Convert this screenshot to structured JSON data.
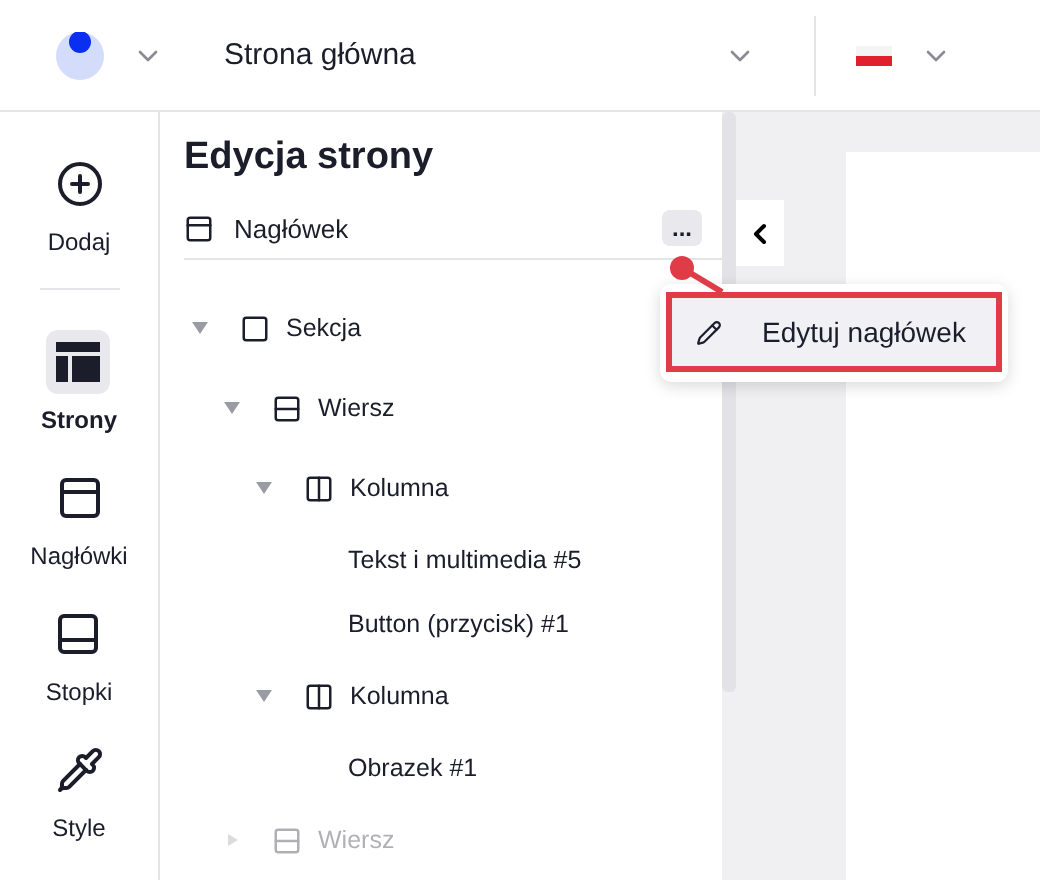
{
  "top_bar": {
    "page_select": {
      "value": "Strona główna"
    }
  },
  "rail": [
    {
      "label": "Dodaj",
      "kind": "add",
      "selected": false
    },
    {
      "label": "Strony",
      "kind": "pages",
      "selected": true
    },
    {
      "label": "Nagłówki",
      "kind": "headers",
      "selected": false
    },
    {
      "label": "Stopki",
      "kind": "footers",
      "selected": false
    },
    {
      "label": "Style",
      "kind": "style",
      "selected": false
    }
  ],
  "panel": {
    "title": "Edycja strony",
    "header_item": {
      "label": "Nagłówek",
      "more": "..."
    },
    "tree": [
      {
        "label": "Sekcja",
        "kind": "section",
        "expanded": true,
        "dimmed": false,
        "children": [
          {
            "label": "Wiersz",
            "kind": "row",
            "expanded": true,
            "dimmed": false,
            "children": [
              {
                "label": "Kolumna",
                "kind": "column",
                "expanded": true,
                "dimmed": false,
                "children": [
                  {
                    "label": "Tekst i multimedia #5",
                    "kind": "element",
                    "dimmed": false
                  },
                  {
                    "label": "Button (przycisk) #1",
                    "kind": "element",
                    "dimmed": false
                  }
                ]
              },
              {
                "label": "Kolumna",
                "kind": "column",
                "expanded": true,
                "dimmed": false,
                "children": [
                  {
                    "label": "Obrazek #1",
                    "kind": "element",
                    "dimmed": false
                  }
                ]
              }
            ]
          },
          {
            "label": "Wiersz",
            "kind": "row",
            "expanded": false,
            "dimmed": true
          }
        ]
      }
    ]
  },
  "menu": {
    "items": [
      {
        "label": "Edytuj nagłówek",
        "highlighted": true
      }
    ]
  }
}
